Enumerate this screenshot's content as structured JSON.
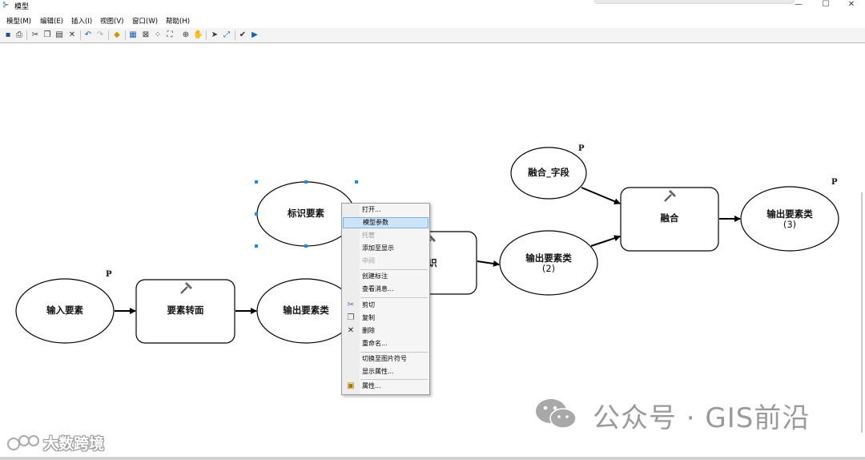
{
  "window": {
    "title": "模型",
    "minimize": "—",
    "maximize": "☐",
    "close": "✕"
  },
  "menu": [
    "模型(M)",
    "编辑(E)",
    "插入(I)",
    "视图(V)",
    "窗口(W)",
    "帮助(H)"
  ],
  "toolbar": [
    "save-icon",
    "print-icon",
    "cut-icon",
    "copy-icon",
    "paste-icon",
    "delete-icon",
    "undo-icon",
    "redo-icon",
    "add-data-icon",
    "auto-layout-icon",
    "full-extent-icon",
    "zoom-in-fixed-icon",
    "zoom-out-fixed-icon",
    "zoom-in-icon",
    "pan-icon",
    "select-icon",
    "connect-icon",
    "validate-icon",
    "run-icon"
  ],
  "diagram": {
    "input_features": "输入要素",
    "feature_to_polygon": "要素转面",
    "output_feature_class": "输出要素类",
    "identify_features": "标识要素",
    "identity_tool_partial": "识",
    "output_feature_class_2": "输出要素类",
    "output_feature_class_2_num": "(2)",
    "dissolve_field": "融合_字段",
    "dissolve": "融合",
    "output_feature_class_3": "输出要素类",
    "output_feature_class_3_num": "(3)",
    "p_marker": "P"
  },
  "context_menu": {
    "items": [
      {
        "label": "打开...",
        "enabled": true
      },
      {
        "label": "模型参数",
        "enabled": true,
        "highlighted": true
      },
      {
        "label": "托管",
        "enabled": false
      },
      {
        "label": "添加至显示",
        "enabled": true
      },
      {
        "label": "中间",
        "enabled": false
      },
      {
        "label": "创建标注",
        "enabled": true
      },
      {
        "label": "查看消息...",
        "enabled": true
      },
      {
        "label": "剪切",
        "enabled": true,
        "icon": "scissors-icon"
      },
      {
        "label": "复制",
        "enabled": true,
        "icon": "copy-icon"
      },
      {
        "label": "删除",
        "enabled": true,
        "icon": "delete-x-icon"
      },
      {
        "label": "重命名...",
        "enabled": true
      },
      {
        "label": "切换至图片符号",
        "enabled": true
      },
      {
        "label": "显示属性...",
        "enabled": true
      },
      {
        "label": "属性...",
        "enabled": true,
        "icon": "properties-icon"
      }
    ]
  },
  "watermarks": {
    "right": "公众号 · GIS前沿",
    "left": "大数跨境"
  },
  "colors": {
    "highlight": "#cde3f7",
    "highlight_border": "#7eb0e0",
    "selection_handle": "#1e88e5",
    "watermark": "#9a9a9a"
  }
}
